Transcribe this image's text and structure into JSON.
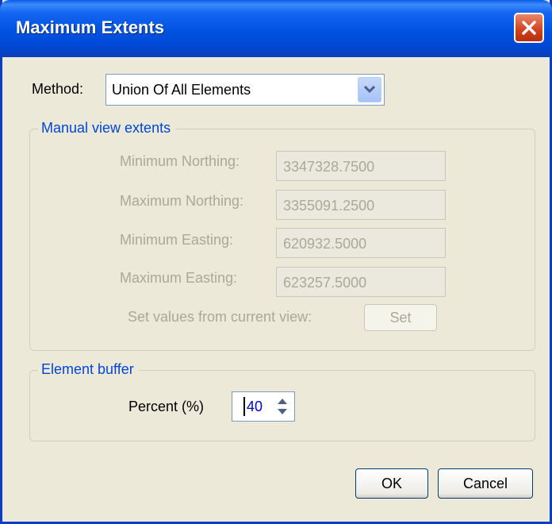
{
  "window": {
    "title": "Maximum Extents"
  },
  "method": {
    "label": "Method:",
    "value": "Union Of All Elements"
  },
  "manual_extents": {
    "title": "Manual view extents",
    "min_northing": {
      "label": "Minimum Northing:",
      "value": "3347328.7500"
    },
    "max_northing": {
      "label": "Maximum Northing:",
      "value": "3355091.2500"
    },
    "min_easting": {
      "label": "Minimum Easting:",
      "value": "620932.5000"
    },
    "max_easting": {
      "label": "Maximum Easting:",
      "value": "623257.5000"
    },
    "set_label": "Set values from current view:",
    "set_button": "Set"
  },
  "element_buffer": {
    "title": "Element buffer",
    "percent_label": "Percent (%)",
    "percent_value": "40"
  },
  "buttons": {
    "ok": "OK",
    "cancel": "Cancel"
  },
  "icons": {
    "close": "close-icon",
    "dropdown": "chevron-down-icon",
    "spin": "spin-arrows-icon"
  },
  "colors": {
    "titlebar": "#0052E0",
    "group_title": "#0046D5",
    "close": "#D0411C"
  }
}
